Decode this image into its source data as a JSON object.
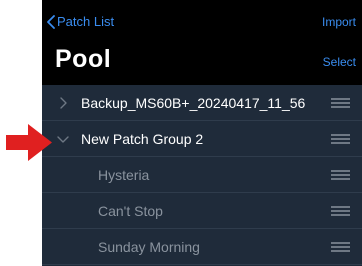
{
  "navbar": {
    "back_label": "Patch List",
    "import_label": "Import",
    "title": "Pool",
    "select_label": "Select"
  },
  "list": [
    {
      "type": "group",
      "label": "Backup_MS60B+_20240417_11_56",
      "expanded": false
    },
    {
      "type": "group",
      "label": "New Patch Group 2",
      "expanded": true
    },
    {
      "type": "child",
      "label": "Hysteria"
    },
    {
      "type": "child",
      "label": "Can't Stop"
    },
    {
      "type": "child",
      "label": "Sunday Morning"
    }
  ],
  "colors": {
    "accent": "#3a8df0",
    "navbar_bg": "#000000",
    "list_bg": "#1f2b3a",
    "arrow": "#e02020"
  },
  "icons": {
    "back": "chevron-left-icon",
    "collapsed": "chevron-right-icon",
    "expanded": "chevron-down-icon",
    "reorder": "reorder-handle-icon",
    "callout": "red-arrow-icon"
  }
}
